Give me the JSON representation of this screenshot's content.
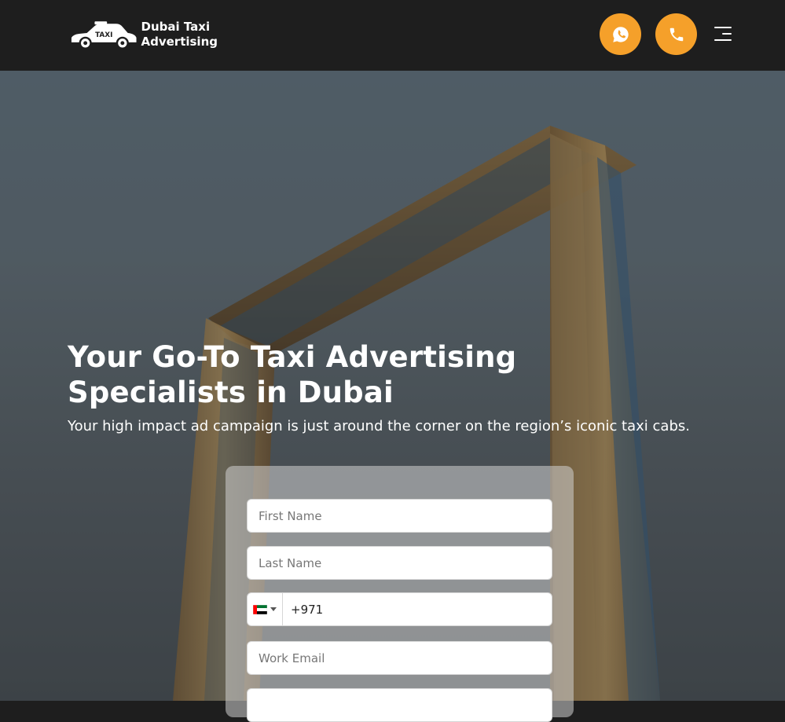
{
  "header": {
    "logo_badge": "TAXI",
    "logo_line1": "Dubai Taxi",
    "logo_line2": "Advertising",
    "whatsapp_icon": "whatsapp-icon",
    "call_icon": "phone-icon",
    "menu_icon": "hamburger-menu-icon",
    "accent_color": "#f5a02a"
  },
  "hero": {
    "title": "Your Go-To Taxi Advertising Specialists in Dubai",
    "subtitle": "Your high impact ad campaign is just around the corner on the region’s iconic taxi cabs."
  },
  "form": {
    "first_name_placeholder": "First Name",
    "last_name_placeholder": "Last Name",
    "country_flag": "uae-flag-icon",
    "phone_value": "+971",
    "email_placeholder": "Work Email"
  }
}
